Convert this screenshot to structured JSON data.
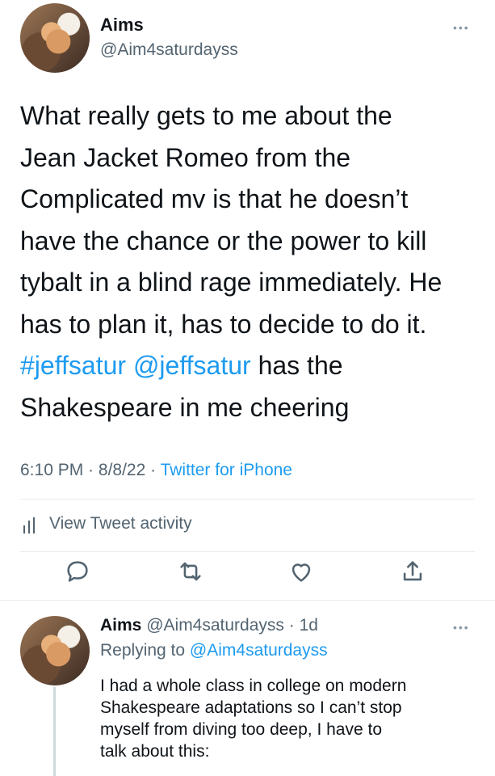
{
  "main_tweet": {
    "display_name": "Aims",
    "handle": "@Aim4saturdayss",
    "more": "•••",
    "lines": [
      "What really gets to me about the",
      "Jean Jacket Romeo from the",
      "Complicated mv is that he doesn’t",
      "have the chance or the power to kill",
      "tybalt in a blind rage immediately. He",
      "has to plan it, has to decide to do it."
    ],
    "hashtag": "#jeffsatur",
    "mention": "@jeffsatur",
    "after_mention": " has the",
    "last_line": "Shakespeare in me cheering",
    "time": "6:10 PM",
    "sep1": " · ",
    "date": "8/8/22",
    "sep2": " · ",
    "source": "Twitter for iPhone",
    "activity_label": "View Tweet activity",
    "actions": [
      "reply-icon",
      "retweet-icon",
      "like-icon",
      "share-icon"
    ]
  },
  "reply_tweet": {
    "display_name": "Aims",
    "handle": "@Aim4saturdayss",
    "sep": " · ",
    "time_ago": "1d",
    "more": "•••",
    "replying_prefix": "Replying to ",
    "replying_handle": "@Aim4saturdayss",
    "lines": [
      "I had a whole class in college on modern",
      "Shakespeare adaptations so I can’t stop",
      "myself from diving too deep, I have to",
      "talk about this:"
    ]
  },
  "colors": {
    "link": "#1d9bf0",
    "secondary": "#536471",
    "divider": "#e6ecf0"
  }
}
